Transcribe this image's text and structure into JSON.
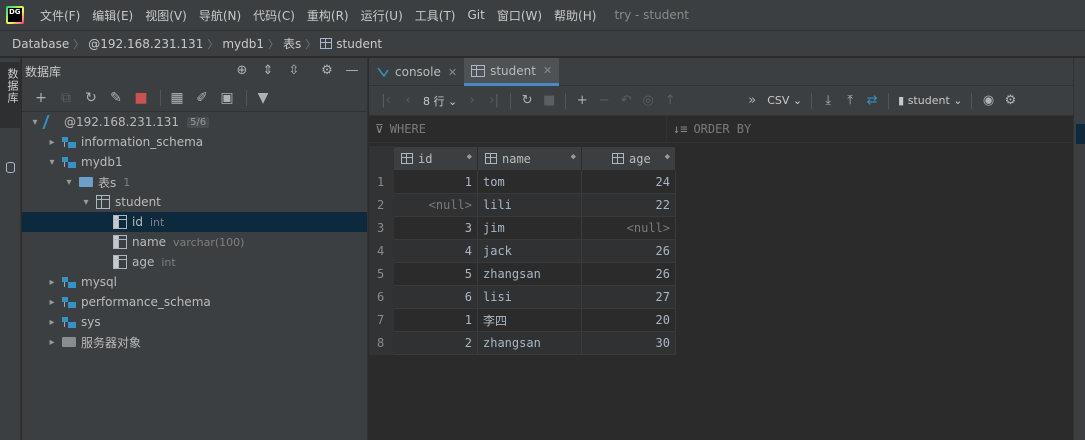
{
  "app": {
    "logo_text": "DG",
    "menu": [
      "文件(F)",
      "编辑(E)",
      "视图(V)",
      "导航(N)",
      "代码(C)",
      "重构(R)",
      "运行(U)",
      "工具(T)",
      "Git",
      "窗口(W)",
      "帮助(H)"
    ],
    "window_title": "try - student"
  },
  "breadcrumb": [
    "Database",
    "@192.168.231.131",
    "mydb1",
    "表s",
    "student"
  ],
  "tool_strip": {
    "label": "数据库"
  },
  "db_panel": {
    "title": "数据库",
    "tree": [
      {
        "label": "@192.168.231.131",
        "badge": "5/6",
        "arrow": "▾",
        "icon": "host",
        "indent": 0
      },
      {
        "label": "information_schema",
        "arrow": "▸",
        "icon": "schema",
        "indent": 1
      },
      {
        "label": "mydb1",
        "arrow": "▾",
        "icon": "schema",
        "indent": 1
      },
      {
        "label": "表s",
        "sub": "1",
        "arrow": "▾",
        "icon": "folder",
        "indent": 2
      },
      {
        "label": "student",
        "arrow": "▾",
        "icon": "table",
        "indent": 3
      },
      {
        "label": "id",
        "sub": "int",
        "arrow": "",
        "icon": "col",
        "indent": 4,
        "selected": true
      },
      {
        "label": "name",
        "sub": "varchar(100)",
        "arrow": "",
        "icon": "col",
        "indent": 4
      },
      {
        "label": "age",
        "sub": "int",
        "arrow": "",
        "icon": "col",
        "indent": 4
      },
      {
        "label": "mysql",
        "arrow": "▸",
        "icon": "schema",
        "indent": 1
      },
      {
        "label": "performance_schema",
        "arrow": "▸",
        "icon": "schema",
        "indent": 1
      },
      {
        "label": "sys",
        "arrow": "▸",
        "icon": "schema",
        "indent": 1
      },
      {
        "label": "服务器对象",
        "arrow": "▸",
        "icon": "folder-gray",
        "indent": 1
      }
    ]
  },
  "editor": {
    "tabs": [
      {
        "label": "console",
        "active": false
      },
      {
        "label": "student",
        "active": true
      }
    ],
    "toolbar": {
      "rows_label": "8 行",
      "export_format": "CSV",
      "session_label": "student"
    },
    "filter": {
      "where": "WHERE",
      "order_by": "ORDER BY"
    },
    "grid": {
      "columns": [
        "id",
        "name",
        "age"
      ],
      "rows": [
        {
          "n": "1",
          "id": "1",
          "name": "tom",
          "age": "24"
        },
        {
          "n": "2",
          "id": "<null>",
          "name": "lili",
          "age": "22"
        },
        {
          "n": "3",
          "id": "3",
          "name": "jim",
          "age": "<null>"
        },
        {
          "n": "4",
          "id": "4",
          "name": "jack",
          "age": "26"
        },
        {
          "n": "5",
          "id": "5",
          "name": "zhangsan",
          "age": "26"
        },
        {
          "n": "6",
          "id": "6",
          "name": "lisi",
          "age": "27"
        },
        {
          "n": "7",
          "id": "1",
          "name": "李四",
          "age": "20"
        },
        {
          "n": "8",
          "id": "2",
          "name": "zhangsan",
          "age": "30"
        }
      ]
    }
  },
  "colors": {
    "accent": "#4a88c7",
    "selection": "#0d293e",
    "background": "#2b2b2b",
    "panel": "#3c3f41"
  }
}
